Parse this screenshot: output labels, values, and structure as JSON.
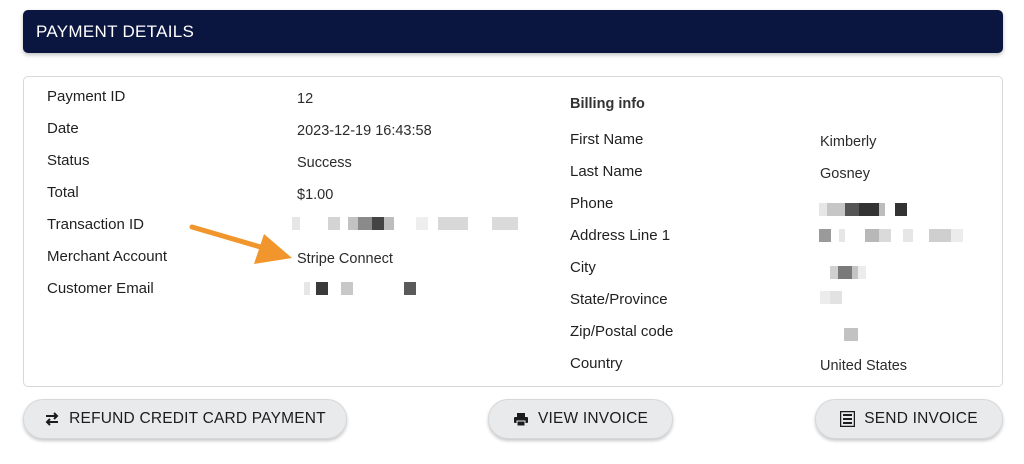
{
  "header": {
    "title": "PAYMENT DETAILS"
  },
  "payment": {
    "rows": [
      {
        "label": "Payment ID",
        "value": "12"
      },
      {
        "label": "Date",
        "value": "2023-12-19 16:43:58"
      },
      {
        "label": "Status",
        "value": "Success"
      },
      {
        "label": "Total",
        "value": "$1.00"
      },
      {
        "label": "Transaction ID",
        "value": ""
      },
      {
        "label": "Merchant Account",
        "value": "Stripe Connect"
      },
      {
        "label": "Customer Email",
        "value": ""
      }
    ]
  },
  "billing": {
    "heading": "Billing info",
    "rows": [
      {
        "label": "First Name",
        "value": "Kimberly"
      },
      {
        "label": "Last Name",
        "value": "Gosney"
      },
      {
        "label": "Phone",
        "value": ""
      },
      {
        "label": "Address Line 1",
        "value": ""
      },
      {
        "label": "City",
        "value": ""
      },
      {
        "label": "State/Province",
        "value": ""
      },
      {
        "label": "Zip/Postal code",
        "value": ""
      },
      {
        "label": "Country",
        "value": "United States"
      }
    ]
  },
  "buttons": {
    "refund": {
      "label": "REFUND CREDIT CARD PAYMENT",
      "icon": "swap-arrows-icon"
    },
    "view": {
      "label": "VIEW INVOICE",
      "icon": "printer-icon"
    },
    "send": {
      "label": "SEND INVOICE",
      "icon": "list-document-icon"
    }
  },
  "colors": {
    "header_bg": "#0b1640",
    "arrow": "#f0962c",
    "button_bg": "#e9eaec"
  }
}
